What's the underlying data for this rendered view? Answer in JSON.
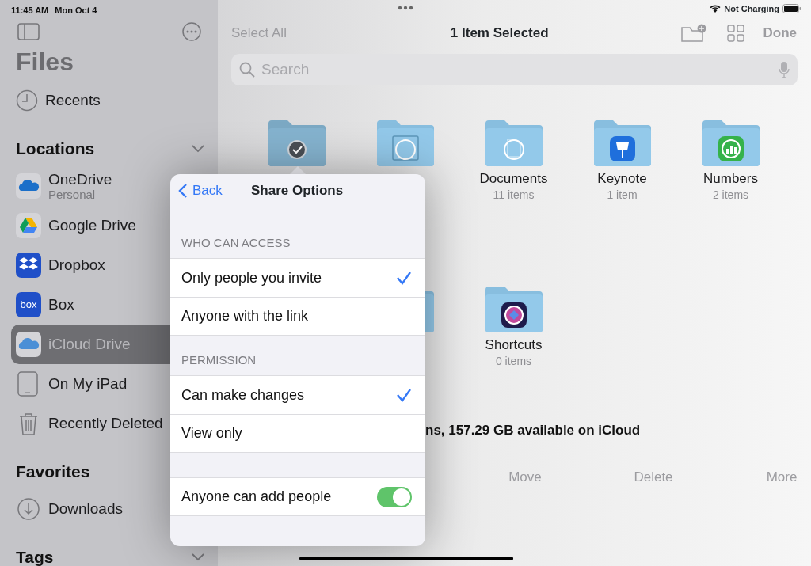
{
  "status_bar": {
    "time": "11:45 AM",
    "date": "Mon Oct 4",
    "charging": "Not Charging"
  },
  "sidebar": {
    "title": "Files",
    "recents": "Recents",
    "sections": [
      {
        "title": "Locations",
        "expanded": true,
        "items": [
          {
            "kind": "onedrive",
            "label": "OneDrive",
            "subtitle": "Personal",
            "selected": false
          },
          {
            "kind": "gdrive",
            "label": "Google Drive",
            "selected": false
          },
          {
            "kind": "dropbox",
            "label": "Dropbox",
            "selected": false
          },
          {
            "kind": "box",
            "label": "Box",
            "icon_text": "box",
            "selected": false
          },
          {
            "kind": "icloud",
            "label": "iCloud Drive",
            "selected": true
          },
          {
            "kind": "ipad",
            "label": "On My iPad",
            "selected": false
          },
          {
            "kind": "trash",
            "label": "Recently Deleted",
            "selected": false
          }
        ]
      },
      {
        "title": "Favorites",
        "items": [
          {
            "kind": "download",
            "label": "Downloads",
            "selected": false
          }
        ]
      },
      {
        "title": "Tags",
        "expanded": true
      }
    ]
  },
  "toolbar": {
    "select_all": "Select All",
    "title": "1 Item Selected",
    "done": "Done"
  },
  "search": {
    "placeholder": "Search"
  },
  "folders": [
    {
      "kind": "check",
      "selected": true
    },
    {
      "kind": "window",
      "selected": false
    },
    {
      "kind": "doc",
      "label": "Documents",
      "count": "11 items",
      "selected": false
    },
    {
      "kind": "keynote",
      "label": "Keynote",
      "count": "1 item",
      "selected": false
    },
    {
      "kind": "numbers",
      "label": "Numbers",
      "count": "2 items",
      "selected": false
    },
    {
      "kind": "hidden"
    },
    {
      "kind": "plain",
      "selected": false
    },
    {
      "kind": "shortcuts",
      "label": "Shortcuts",
      "count": "0 items",
      "selected": false
    }
  ],
  "footer": "ns, 157.29 GB available on iCloud",
  "actions": [
    "Move",
    "Delete",
    "More"
  ],
  "popover": {
    "back": "Back",
    "title": "Share Options",
    "groups": [
      {
        "header": "WHO CAN ACCESS",
        "options": [
          {
            "label": "Only people you invite",
            "selected": true
          },
          {
            "label": "Anyone with the link",
            "selected": false
          }
        ]
      },
      {
        "header": "PERMISSION",
        "options": [
          {
            "label": "Can make changes",
            "selected": true
          },
          {
            "label": "View only",
            "selected": false
          }
        ]
      }
    ],
    "toggle": {
      "label": "Anyone can add people",
      "on": true
    }
  }
}
